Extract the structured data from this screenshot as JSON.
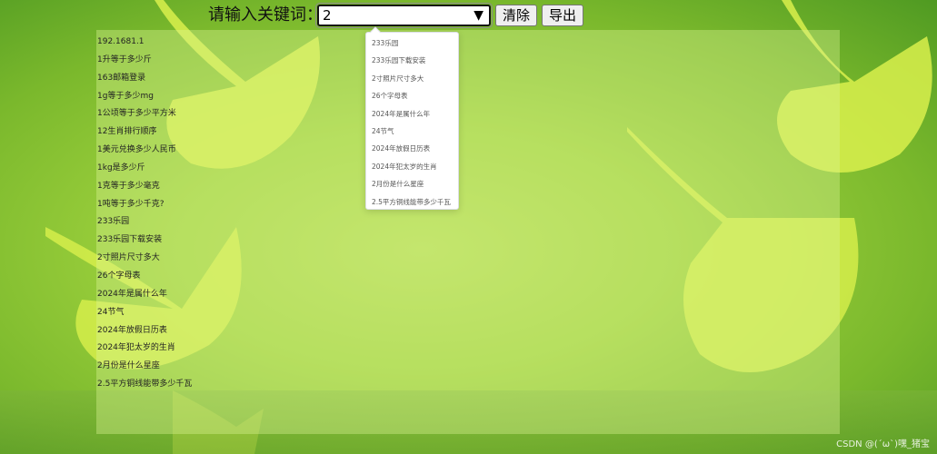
{
  "search": {
    "label": "请输入关键词：",
    "value": "2",
    "caret": "▼"
  },
  "buttons": {
    "clear": "清除",
    "export": "导出"
  },
  "dropdown": {
    "options": [
      "233乐园",
      "233乐园下载安装",
      "2寸照片尺寸多大",
      "26个字母表",
      "2024年是属什么年",
      "24节气",
      "2024年放假日历表",
      "2024年犯太岁的生肖",
      "2月份是什么星座",
      "2.5平方铜线能带多少千瓦"
    ]
  },
  "results": [
    "192.1681.1",
    "1升等于多少斤",
    "163邮箱登录",
    "1g等于多少mg",
    "1公顷等于多少平方米",
    "12生肖排行顺序",
    "1美元兑换多少人民币",
    "1kg是多少斤",
    "1克等于多少毫克",
    "1吨等于多少千克?",
    "233乐园",
    "233乐园下载安装",
    "2寸照片尺寸多大",
    "26个字母表",
    "2024年是属什么年",
    "24节气",
    "2024年放假日历表",
    "2024年犯太岁的生肖",
    "2月份是什么星座",
    "2.5平方铜线能带多少千瓦"
  ],
  "watermark": "CSDN @(ˊωˋ)嘿_猪宝",
  "colors": {
    "background": "#9fd23e",
    "leaf": "#d6ef4a"
  }
}
